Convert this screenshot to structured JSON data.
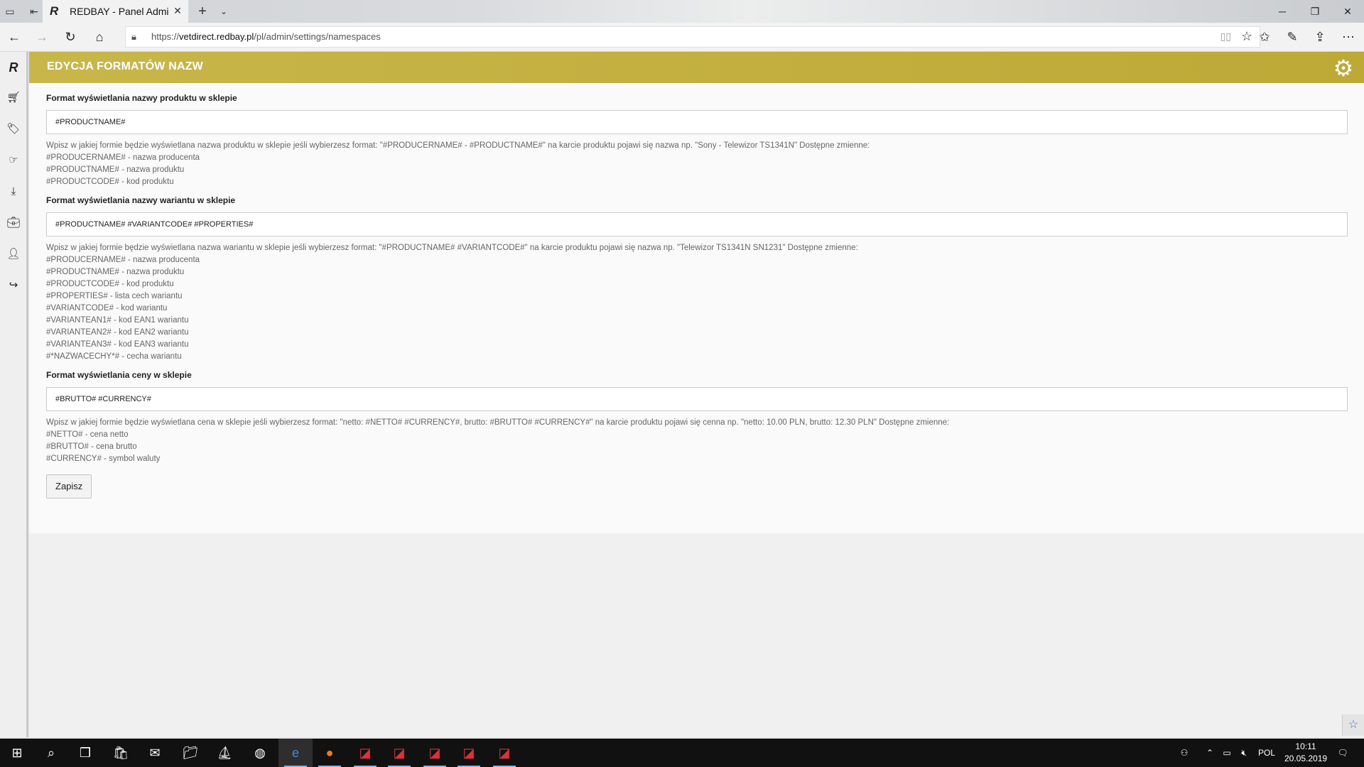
{
  "browser": {
    "tab_title": "REDBAY - Panel Admini",
    "url_prefix": "https://",
    "url_host": "vetdirect.redbay.pl",
    "url_path": "/pl/admin/settings/namespaces"
  },
  "page": {
    "title": "EDYCJA FORMATÓW NAZW"
  },
  "form": {
    "product": {
      "label": "Format wyświetlania nazwy produktu w sklepie",
      "value": "#PRODUCTNAME#",
      "help": "Wpisz w jakiej formie będzie wyświetlana nazwa produktu w sklepie jeśli wybierzesz format: \"#PRODUCERNAME# - #PRODUCTNAME#\" na karcie produktu pojawi się nazwa np. \"Sony - Telewizor TS1341N\" Dostępne zmienne:",
      "vars": [
        "#PRODUCERNAME# - nazwa producenta",
        "#PRODUCTNAME# - nazwa produktu",
        "#PRODUCTCODE# - kod produktu"
      ]
    },
    "variant": {
      "label": "Format wyświetlania nazwy wariantu w sklepie",
      "value": "#PRODUCTNAME# #VARIANTCODE# #PROPERTIES#",
      "help": "Wpisz w jakiej formie będzie wyświetlana nazwa wariantu w sklepie jeśli wybierzesz format: \"#PRODUCTNAME# #VARIANTCODE#\" na karcie produktu pojawi się nazwa np. \"Telewizor TS1341N SN1231\" Dostępne zmienne:",
      "vars": [
        "#PRODUCERNAME# - nazwa producenta",
        "#PRODUCTNAME# - nazwa produktu",
        "#PRODUCTCODE# - kod produktu",
        "#PROPERTIES# - lista cech wariantu",
        "#VARIANTCODE# - kod wariantu",
        "#VARIANTEAN1# - kod EAN1 wariantu",
        "#VARIANTEAN2# - kod EAN2 wariantu",
        "#VARIANTEAN3# - kod EAN3 wariantu",
        "#*NAZWACECHY*# - cecha wariantu"
      ]
    },
    "price": {
      "label": "Format wyświetlania ceny w sklepie",
      "value": "#BRUTTO# #CURRENCY#",
      "help": "Wpisz w jakiej formie będzie wyświetlana cena w sklepie jeśli wybierzesz format: \"netto: #NETTO# #CURRENCY#, brutto: #BRUTTO# #CURRENCY#\" na karcie produktu pojawi się cenna np. \"netto: 10.00 PLN, brutto: 12.30 PLN\" Dostępne zmienne:",
      "vars": [
        "#NETTO# - cena netto",
        "#BRUTTO# - cena brutto",
        "#CURRENCY# - symbol waluty"
      ]
    },
    "save_label": "Zapisz"
  },
  "taskbar": {
    "lang": "POL",
    "time": "10:11",
    "date": "20.05.2019"
  }
}
